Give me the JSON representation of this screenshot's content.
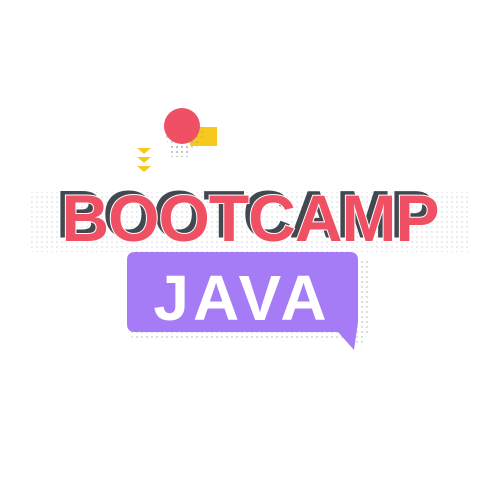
{
  "headline": {
    "text": "BOOTCAMP"
  },
  "bubble": {
    "text": "JAVA"
  },
  "colors": {
    "headline_fill": "#ef5064",
    "headline_shadow": "#222a33",
    "bubble_fill": "#a57bf6",
    "accent_yellow": "#f7c81e",
    "accent_red": "#ef5064"
  },
  "icons": {
    "circle": "red-circle-icon",
    "square": "yellow-square-icon",
    "arrows": "chevron-down-arrows-icon",
    "bubble": "speech-bubble-icon"
  }
}
